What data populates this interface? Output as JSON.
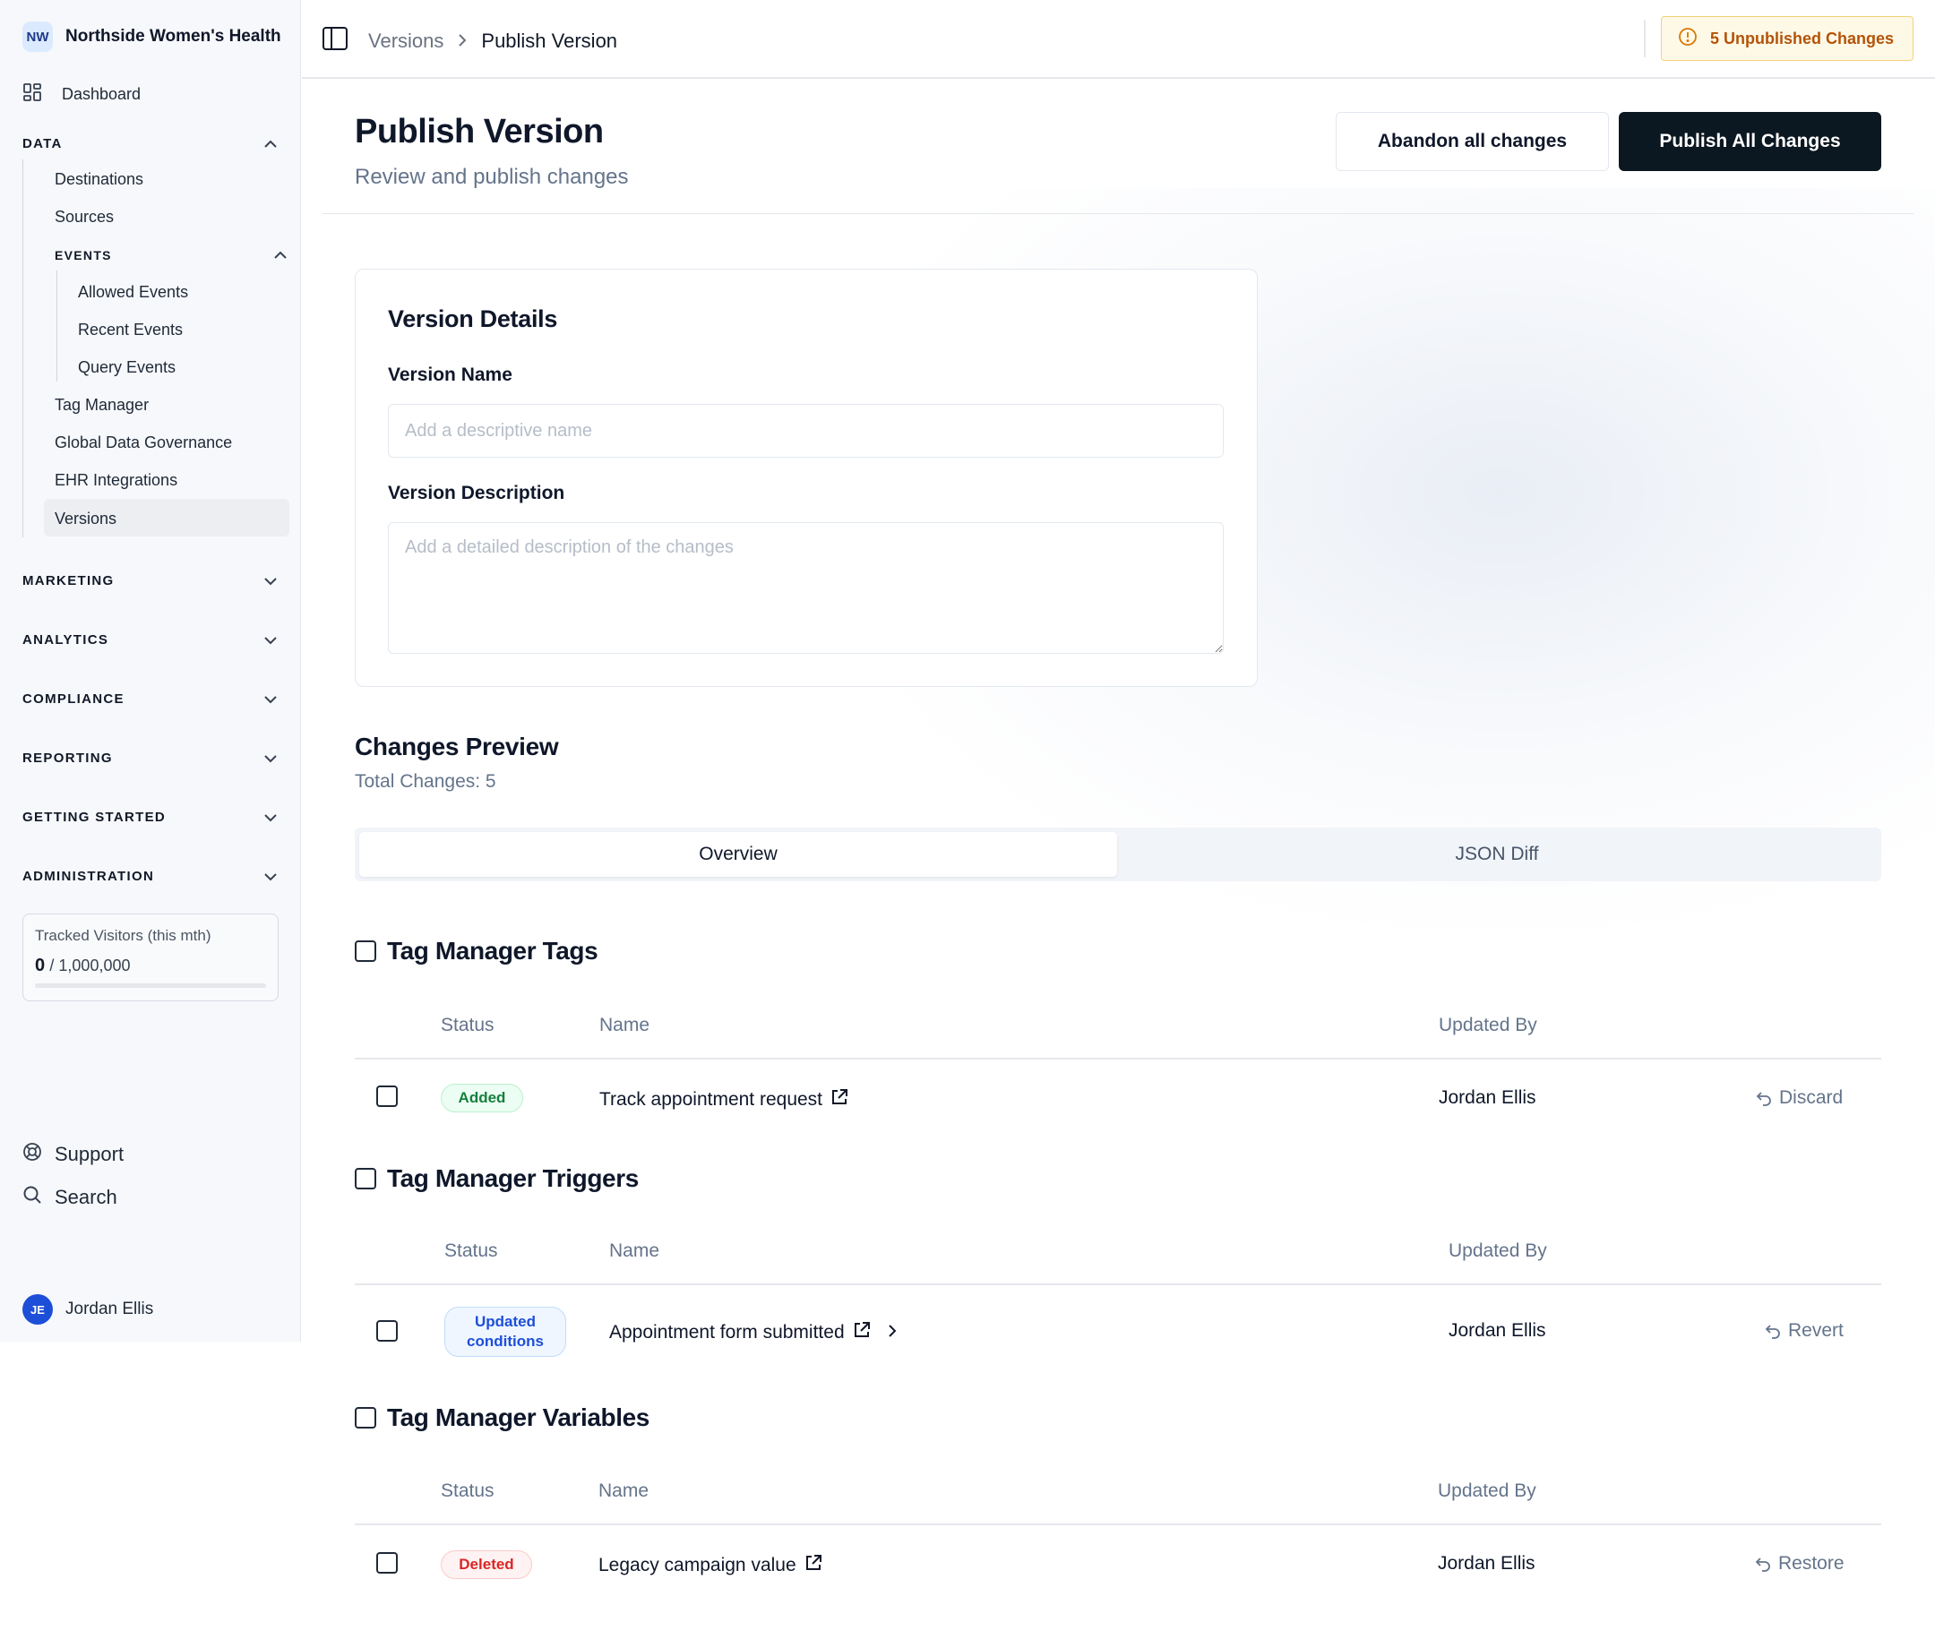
{
  "sidebar": {
    "brand_initials": "NW",
    "brand_name": "Northside Women's Health",
    "dashboard": "Dashboard",
    "data_section": "DATA",
    "data_items": [
      "Destinations",
      "Sources"
    ],
    "events_section": "EVENTS",
    "event_items": [
      "Allowed Events",
      "Recent Events",
      "Query Events"
    ],
    "data_items_2": [
      "Tag Manager",
      "Global Data Governance",
      "EHR Integrations",
      "Versions"
    ],
    "sections": [
      "MARKETING",
      "ANALYTICS",
      "COMPLIANCE",
      "REPORTING",
      "GETTING STARTED",
      "ADMINISTRATION"
    ],
    "visitors_label": "Tracked Visitors (this mth)",
    "visitors_count": "0",
    "visitors_limit": "/ 1,000,000",
    "visitors_progress": 0,
    "support": "Support",
    "search": "Search",
    "user_initials": "JE",
    "user_name": "Jordan Ellis"
  },
  "topbar": {
    "crumb_parent": "Versions",
    "crumb_current": "Publish Version",
    "unpublished": "5 Unpublished Changes"
  },
  "page": {
    "title": "Publish Version",
    "subtitle": "Review and publish changes",
    "abandon_label": "Abandon all changes",
    "publish_label": "Publish All Changes"
  },
  "details": {
    "title": "Version Details",
    "name_label": "Version Name",
    "name_placeholder": "Add a descriptive name",
    "name_value": "",
    "desc_label": "Version Description",
    "desc_placeholder": "Add a detailed description of the changes",
    "desc_value": ""
  },
  "preview": {
    "title": "Changes Preview",
    "total": "Total Changes: 5",
    "tabs": [
      "Overview",
      "JSON Diff"
    ],
    "active_tab": "Overview"
  },
  "groups": [
    {
      "title": "Tag Manager Tags",
      "columns": [
        "Status",
        "Name",
        "Updated By"
      ],
      "rows": [
        {
          "status": "Added",
          "name": "Track appointment request",
          "updated_by": "Jordan Ellis",
          "action": "Discard"
        }
      ]
    },
    {
      "title": "Tag Manager Triggers",
      "columns": [
        "Status",
        "Name",
        "Updated By"
      ],
      "rows": [
        {
          "status": "Updated conditions",
          "name": "Appointment form submitted",
          "updated_by": "Jordan Ellis",
          "action": "Revert"
        }
      ]
    },
    {
      "title": "Tag Manager Variables",
      "columns": [
        "Status",
        "Name",
        "Updated By"
      ],
      "rows": [
        {
          "status": "Deleted",
          "name": "Legacy campaign value",
          "updated_by": "Jordan Ellis",
          "action": "Restore"
        }
      ]
    }
  ],
  "colors": {
    "primary_dark": "#0b1721",
    "warning_text": "#b45309",
    "warning_bg": "#fef9e6",
    "added": "#15803d",
    "updated": "#1d4ed8",
    "deleted": "#dc2626"
  }
}
